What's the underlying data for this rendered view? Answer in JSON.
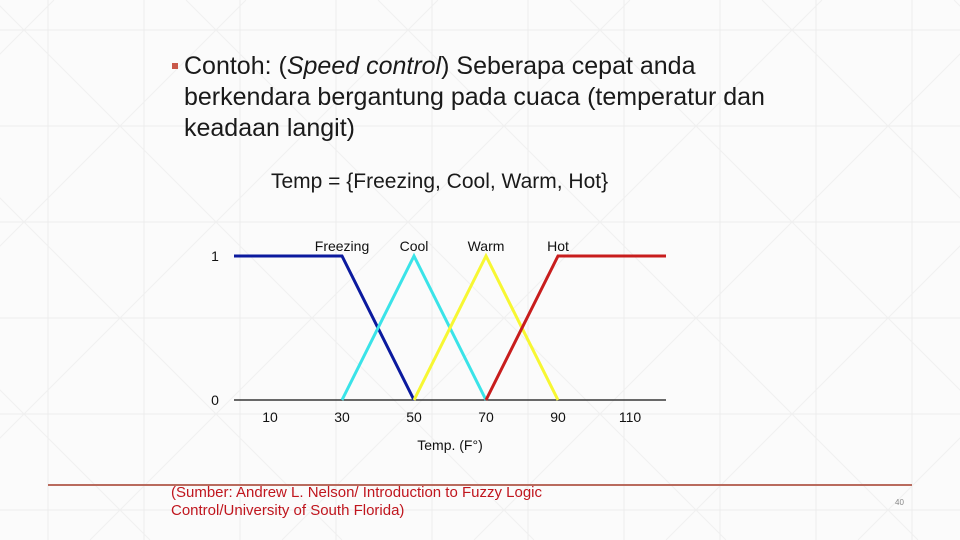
{
  "slide": {
    "bullet": {
      "prefix": "Contoh: (",
      "italic": "Speed control",
      "suffix": ") Seberapa cepat anda berkendara bergantung pada cuaca (temperatur dan keadaan langit)"
    },
    "set_definition": "Temp = {Freezing, Cool, Warm, Hot}",
    "source": "(Sumber: Andrew L. Nelson/ Introduction to Fuzzy Logic Control/University of South Florida)",
    "page_number": "40",
    "colors": {
      "bullet": "#c9594a",
      "footer_line": "#b96b5e",
      "source_text": "#c0161e"
    }
  },
  "chart_data": {
    "type": "line",
    "title": "",
    "xlabel": "Temp. (F°)",
    "ylabel": "",
    "xlim": [
      0,
      120
    ],
    "ylim": [
      0,
      1
    ],
    "x_ticks": [
      10,
      30,
      50,
      70,
      90,
      110
    ],
    "y_ticks": [
      0,
      1
    ],
    "grid": false,
    "legend": "labels above peaks",
    "series": [
      {
        "name": "Freezing",
        "color": "#0b1a9e",
        "x": [
          0,
          30,
          50
        ],
        "y": [
          1,
          1,
          0
        ],
        "label_x": 30
      },
      {
        "name": "Cool",
        "color": "#3ae3e8",
        "x": [
          30,
          50,
          70
        ],
        "y": [
          0,
          1,
          0
        ],
        "label_x": 50
      },
      {
        "name": "Warm",
        "color": "#f7f732",
        "x": [
          50,
          70,
          90
        ],
        "y": [
          0,
          1,
          0
        ],
        "label_x": 70
      },
      {
        "name": "Hot",
        "color": "#c81d1d",
        "x": [
          70,
          90,
          120
        ],
        "y": [
          0,
          1,
          1
        ],
        "label_x": 90
      }
    ]
  }
}
